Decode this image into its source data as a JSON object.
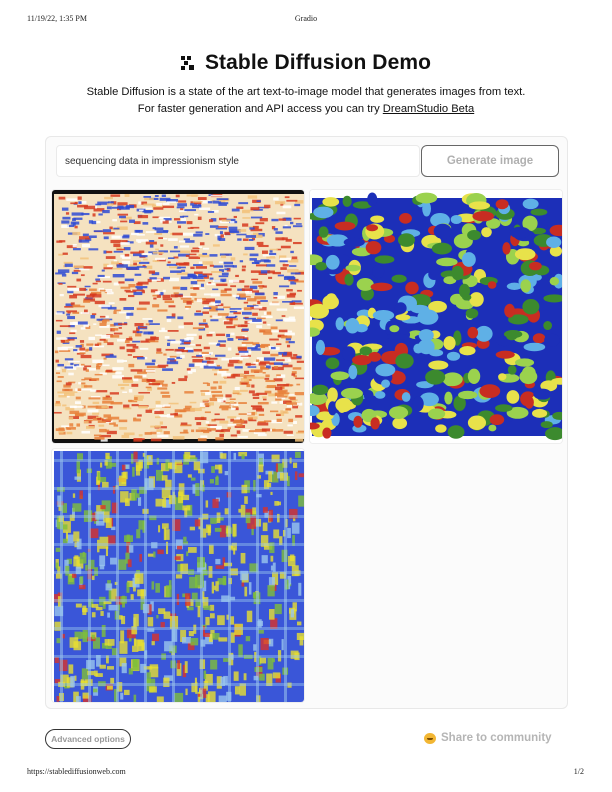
{
  "print_header": {
    "date": "11/19/22, 1:35 PM",
    "title": "Gradio"
  },
  "app": {
    "title": "Stable Diffusion Demo",
    "description_line1": "Stable Diffusion is a state of the art text-to-image model that generates images from text.",
    "description_line2_prefix": "For faster generation and API access you can try ",
    "description_link": "DreamStudio Beta"
  },
  "prompt": {
    "value": "sequencing data in impressionism style"
  },
  "generate_button": {
    "label": "Generate image"
  },
  "gallery": {
    "images": [
      {
        "name": "generated-image-1",
        "palette": [
          "#d63a1e",
          "#2f4bd3",
          "#f2c27a",
          "#ffffff",
          "#e8803a"
        ]
      },
      {
        "name": "generated-image-2",
        "palette": [
          "#e8e24a",
          "#9bd24e",
          "#1c2fb8",
          "#c82d22",
          "#5fb0e6",
          "#3c8a2e"
        ]
      },
      {
        "name": "generated-image-3",
        "palette": [
          "#3a56d8",
          "#e8e030",
          "#7fbf3a",
          "#d9322b",
          "#9ac6ee"
        ]
      }
    ]
  },
  "advanced_options": {
    "label": "Advanced options"
  },
  "share": {
    "label": "Share to community",
    "icon": "hugging-face-icon",
    "icon_color": "#f2b633"
  },
  "print_footer": {
    "url": "https://stablediffusionweb.com",
    "page": "1/2"
  }
}
